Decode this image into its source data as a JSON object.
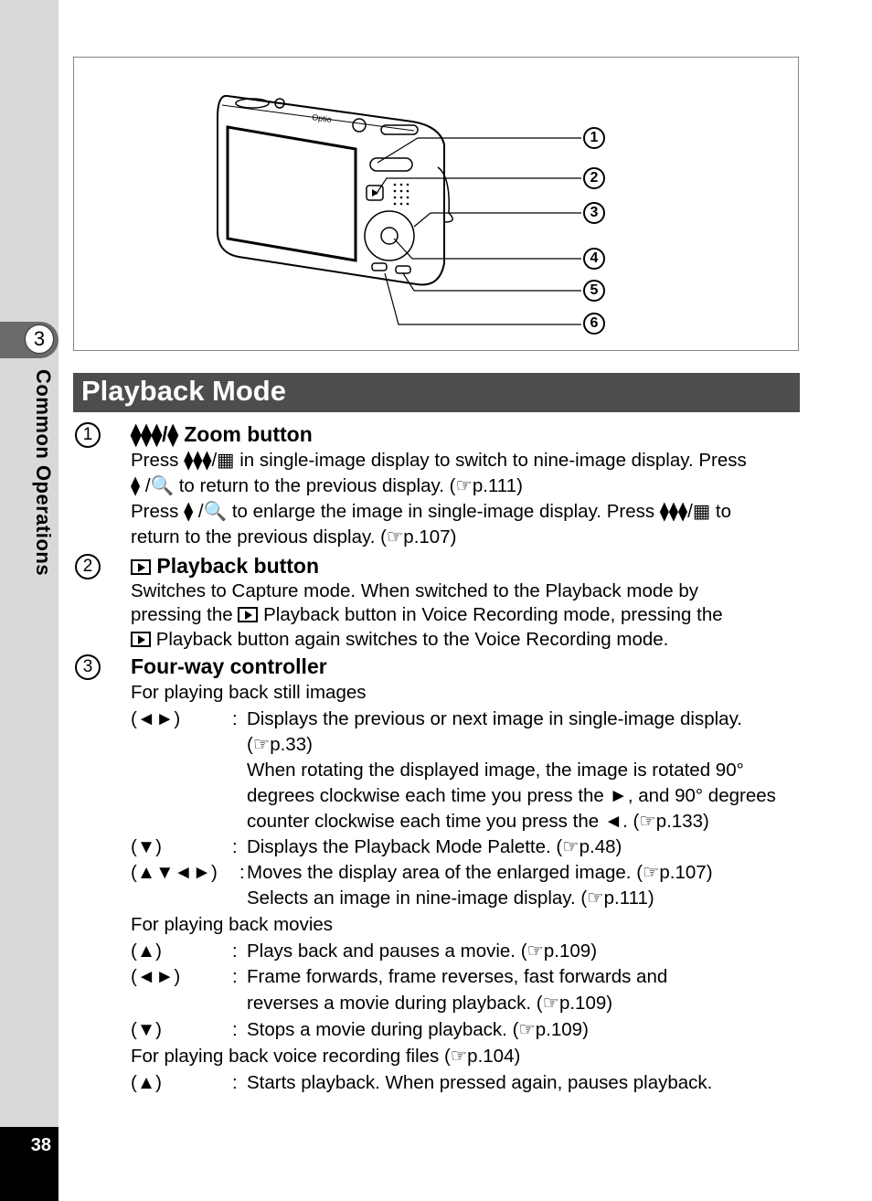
{
  "sidebar": {
    "chapter_number": "3",
    "chapter_title": "Common Operations",
    "page_number": "38"
  },
  "figure": {
    "brand_text": "Optio",
    "callouts": [
      "1",
      "2",
      "3",
      "4",
      "5",
      "6"
    ]
  },
  "section": {
    "title": "Playback Mode"
  },
  "items": [
    {
      "number": "1",
      "heading_icons": "⧫⧫⧫/⧫",
      "heading": "Zoom button",
      "lines": [
        "Press ⧫⧫⧫/▦ in single-image display to switch to nine-image display. Press",
        "⧫ /🔍 to return to the previous display. (☞p.111)",
        "Press ⧫ /🔍 to enlarge the image in single-image display. Press ⧫⧫⧫/▦ to",
        "return to the previous display. (☞p.107)"
      ]
    },
    {
      "number": "2",
      "heading": "Playback button",
      "lines": [
        "Switches to Capture mode. When switched to the Playback mode by",
        "Playback button in Voice Recording mode, pressing the",
        "Playback button again switches to the Voice Recording mode."
      ],
      "line2_prefix": "pressing the"
    },
    {
      "number": "3",
      "heading": "Four-way controller",
      "groups": [
        {
          "title": "For playing back still images",
          "rows": [
            {
              "key": "(◄►)",
              "lines": [
                "Displays the previous or next image in single-image display.",
                "(☞p.33)",
                "When rotating the displayed image, the image is rotated 90°",
                "degrees clockwise each time you press the ►, and 90° degrees",
                "counter clockwise each time you press the ◄. (☞p.133)"
              ]
            },
            {
              "key": "(▼)",
              "lines": [
                "Displays the Playback Mode Palette. (☞p.48)"
              ]
            },
            {
              "key": "(▲▼◄►)",
              "lines": [
                "Moves the display area of the enlarged image. (☞p.107)",
                "Selects an image in nine-image display. (☞p.111)"
              ]
            }
          ]
        },
        {
          "title": "For playing back movies",
          "rows": [
            {
              "key": "(▲)",
              "lines": [
                "Plays back and pauses a movie. (☞p.109)"
              ]
            },
            {
              "key": "(◄►)",
              "lines": [
                "Frame forwards, frame reverses, fast forwards and",
                "reverses a movie during playback. (☞p.109)"
              ]
            },
            {
              "key": "(▼)",
              "lines": [
                "Stops a movie during playback. (☞p.109)"
              ]
            }
          ]
        },
        {
          "title": "For playing back voice recording files (☞p.104)",
          "rows": [
            {
              "key": "(▲)",
              "lines": [
                "Starts playback. When pressed again, pauses playback."
              ]
            }
          ]
        }
      ]
    }
  ],
  "colon": ":"
}
